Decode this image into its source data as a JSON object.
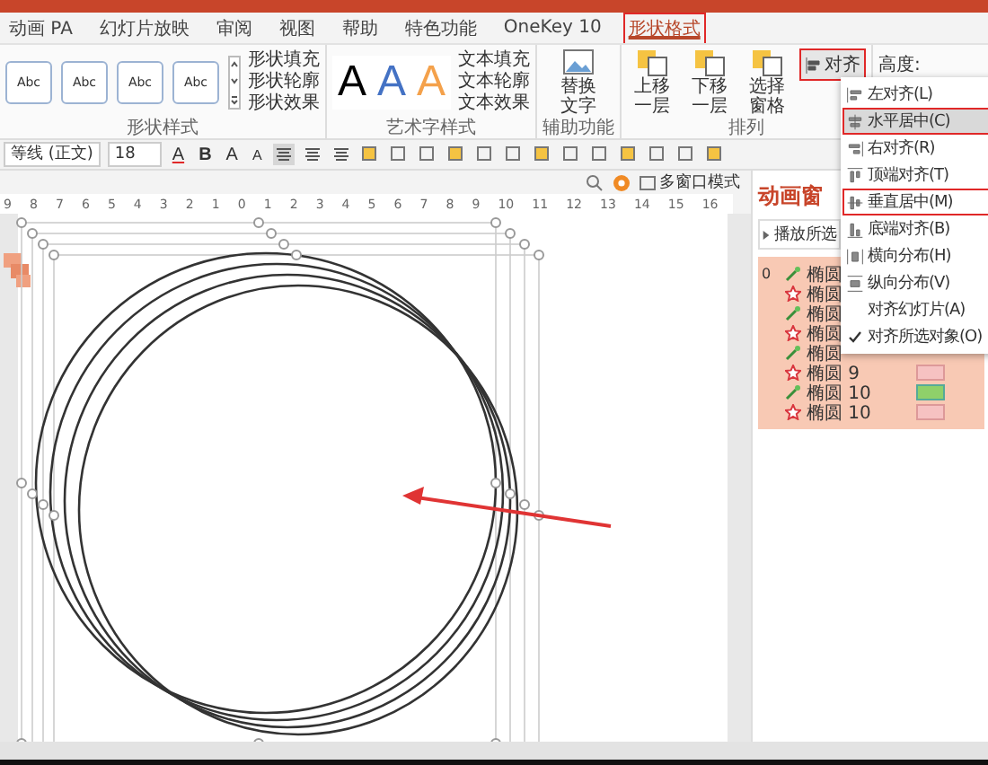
{
  "tabs": [
    {
      "label": "动画 PA",
      "selected": false,
      "outlined": false
    },
    {
      "label": "幻灯片放映",
      "selected": false,
      "outlined": false
    },
    {
      "label": "审阅",
      "selected": false,
      "outlined": false
    },
    {
      "label": "视图",
      "selected": false,
      "outlined": false
    },
    {
      "label": "帮助",
      "selected": false,
      "outlined": false
    },
    {
      "label": "特色功能",
      "selected": false,
      "outlined": false
    },
    {
      "label": "OneKey 10",
      "selected": false,
      "outlined": false
    },
    {
      "label": "形状格式",
      "selected": true,
      "outlined": true
    }
  ],
  "shape_styles": {
    "thumbnails": [
      "Abc",
      "Abc",
      "Abc",
      "Abc"
    ],
    "commands": [
      "形状填充",
      "形状轮廓",
      "形状效果"
    ],
    "group_label": "形状样式"
  },
  "wordart_styles": {
    "letters": [
      "A",
      "A",
      "A"
    ],
    "commands": [
      "文本填充",
      "文本轮廓",
      "文本效果"
    ],
    "group_label": "艺术字样式"
  },
  "accessibility": {
    "button": "替换文字",
    "group_label": "辅助功能"
  },
  "arrange": {
    "buttons": [
      "上移一层",
      "下移一层",
      "选择窗格"
    ],
    "group_label": "排列",
    "align_button": {
      "label": "对齐",
      "outlined": true
    }
  },
  "size": {
    "label": "高度:"
  },
  "format_bar": {
    "font": "等线 (正文)",
    "size": "18",
    "font_color": "A",
    "bold": "B",
    "grow": "A",
    "shrink": "A"
  },
  "view_bar": {
    "multi_window": "多窗口模式"
  },
  "ruler": [
    "9",
    "8",
    "7",
    "6",
    "5",
    "4",
    "3",
    "2",
    "1",
    "0",
    "1",
    "2",
    "3",
    "4",
    "5",
    "6",
    "7",
    "8",
    "9",
    "10",
    "11",
    "12",
    "13",
    "14",
    "15",
    "16"
  ],
  "animation_pane": {
    "title": "动画窗",
    "play_button": "播放所选",
    "rows": [
      {
        "number": "0",
        "kind": "entrance",
        "name": "椭圆"
      },
      {
        "kind": "emphasis",
        "name": "椭圆"
      },
      {
        "kind": "entrance",
        "name": "椭圆"
      },
      {
        "kind": "emphasis",
        "name": "椭圆"
      },
      {
        "kind": "entrance",
        "name": "椭圆"
      },
      {
        "kind": "emphasis",
        "name": "椭圆 9",
        "bar": true
      },
      {
        "kind": "entrance",
        "name": "椭圆 10",
        "bar": true
      },
      {
        "kind": "emphasis",
        "name": "椭圆 10",
        "bar": true
      }
    ]
  },
  "align_menu": [
    {
      "label": "左对齐(L)",
      "kind": "left",
      "selected": false,
      "outlined": false
    },
    {
      "label": "水平居中(C)",
      "kind": "center",
      "selected": true,
      "outlined": true
    },
    {
      "label": "右对齐(R)",
      "kind": "right",
      "selected": false,
      "outlined": false
    },
    {
      "label": "顶端对齐(T)",
      "kind": "top",
      "selected": false,
      "outlined": false
    },
    {
      "label": "垂直居中(M)",
      "kind": "middle",
      "selected": false,
      "outlined": true
    },
    {
      "label": "底端对齐(B)",
      "kind": "bottom",
      "selected": false,
      "outlined": false
    },
    {
      "label": "横向分布(H)",
      "kind": "hdist",
      "selected": false,
      "outlined": false
    },
    {
      "label": "纵向分布(V)",
      "kind": "vdist",
      "selected": false,
      "outlined": false
    },
    {
      "label": "对齐幻灯片(A)",
      "kind": "option",
      "checked": false,
      "selected": false,
      "outlined": false
    },
    {
      "label": "对齐所选对象(O)",
      "kind": "option",
      "checked": true,
      "selected": false,
      "outlined": false
    }
  ]
}
